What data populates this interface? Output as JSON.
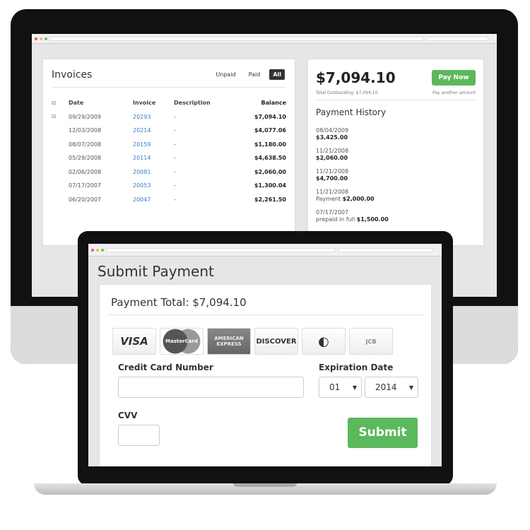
{
  "invoices": {
    "title": "Invoices",
    "filters": [
      "Unpaid",
      "Paid",
      "All"
    ],
    "active_filter": "All",
    "columns": [
      "Date",
      "Invoice",
      "Description",
      "Balance"
    ],
    "rows": [
      {
        "date": "09/29/2009",
        "invoice": "20293",
        "description": "-",
        "balance": "$7,094.10",
        "checked": true
      },
      {
        "date": "12/03/2008",
        "invoice": "20214",
        "description": "-",
        "balance": "$4,077.06",
        "checked": false
      },
      {
        "date": "08/07/2008",
        "invoice": "20159",
        "description": "-",
        "balance": "$1,180.00",
        "checked": false
      },
      {
        "date": "05/29/2008",
        "invoice": "20114",
        "description": "-",
        "balance": "$4,638.50",
        "checked": false
      },
      {
        "date": "02/06/2008",
        "invoice": "20081",
        "description": "-",
        "balance": "$2,060.00",
        "checked": false
      },
      {
        "date": "07/17/2007",
        "invoice": "20053",
        "description": "-",
        "balance": "$1,300.04",
        "checked": false
      },
      {
        "date": "06/20/2007",
        "invoice": "20047",
        "description": "-",
        "balance": "$2,261.50",
        "checked": false
      }
    ]
  },
  "summary": {
    "amount": "$7,094.10",
    "pay_now": "Pay Now",
    "total_outstanding": "Total Outstanding: $7,094.10",
    "pay_another": "Pay another amount"
  },
  "history": {
    "title": "Payment History",
    "items": [
      {
        "date": "08/04/2009",
        "prefix": "",
        "amount": "$3,425.00"
      },
      {
        "date": "11/21/2008",
        "prefix": "",
        "amount": "$2,060.00"
      },
      {
        "date": "11/21/2008",
        "prefix": "",
        "amount": "$4,700.00"
      },
      {
        "date": "11/21/2008",
        "prefix": "Payment ",
        "amount": "$2,000.00"
      },
      {
        "date": "07/17/2007",
        "prefix": "prepaid in full ",
        "amount": "$1,500.00"
      }
    ]
  },
  "submit": {
    "title": "Submit Payment",
    "total": "Payment Total: $7,094.10",
    "cards": [
      "VISA",
      "MasterCard",
      "AMERICAN EXPRESS",
      "DISCOVER",
      "Diners Club",
      "JCB"
    ],
    "selected_card": "AMERICAN EXPRESS",
    "cc_label": "Credit Card Number",
    "cc_value": "",
    "exp_label": "Expiration Date",
    "month": "01",
    "year": "2014",
    "cvv_label": "CVV",
    "cvv_value": "",
    "submit_label": "Submit"
  },
  "colors": {
    "green": "#5cb85c",
    "link": "#3a7bc8"
  }
}
